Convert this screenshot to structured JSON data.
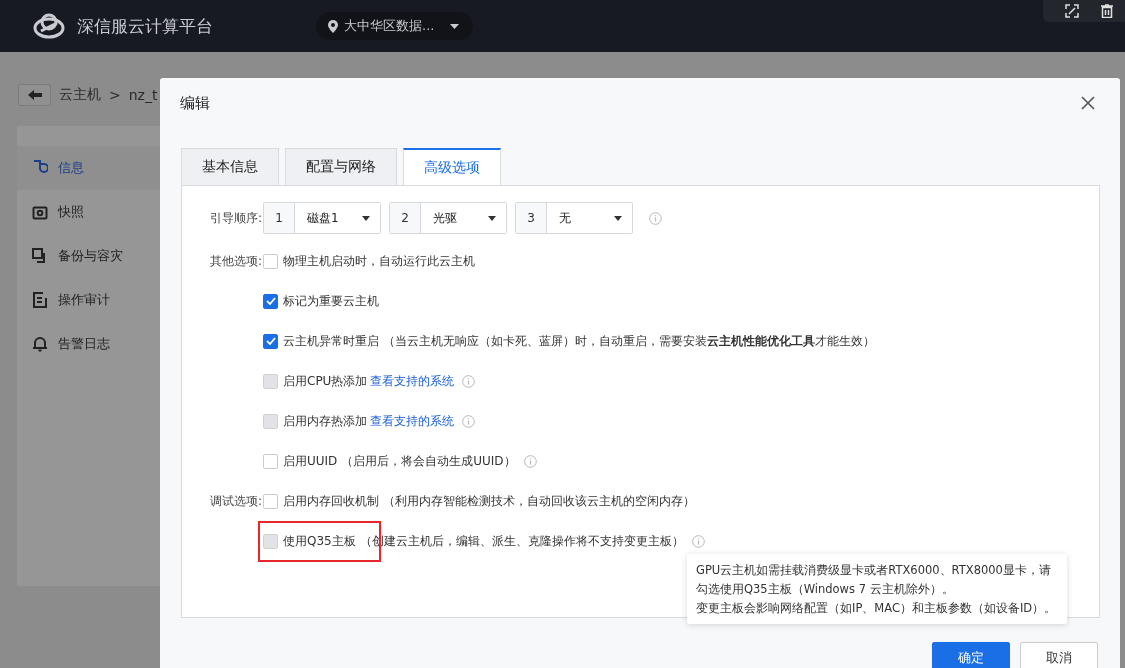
{
  "header": {
    "title": "深信服云计算平台",
    "region": "大中华区数据..."
  },
  "breadcrumb": {
    "items": [
      "云主机",
      ">",
      "nz_t"
    ]
  },
  "sidebar": {
    "items": [
      {
        "label": "信息",
        "selected": true
      },
      {
        "label": "快照",
        "selected": false
      },
      {
        "label": "备份与容灾",
        "selected": false
      },
      {
        "label": "操作审计",
        "selected": false
      },
      {
        "label": "告警日志",
        "selected": false
      }
    ]
  },
  "dialog": {
    "title": "编辑",
    "tabs": [
      {
        "label": "基本信息",
        "selected": false
      },
      {
        "label": "配置与网络",
        "selected": false
      },
      {
        "label": "高级选项",
        "selected": true
      }
    ],
    "boot_order": {
      "label": "引导顺序:",
      "slots": [
        {
          "index": "1",
          "value": "磁盘1"
        },
        {
          "index": "2",
          "value": "光驱"
        },
        {
          "index": "3",
          "value": "无"
        }
      ]
    },
    "groups": [
      {
        "label": "其他选项:",
        "options": [
          {
            "label": "物理主机启动时，自动运行此云主机",
            "checked": false,
            "disabled": false
          },
          {
            "label": "标记为重要云主机",
            "checked": true,
            "disabled": false
          },
          {
            "label": "云主机异常时重启 （当云主机无响应（如卡死、蓝屏）时，自动重启，需要安装**云主机性能优化工具**才能生效）",
            "checked": true,
            "disabled": false
          },
          {
            "label": "启用CPU热添加",
            "link": "查看支持的系统",
            "info": true,
            "checked": false,
            "disabled": true
          },
          {
            "label": "启用内存热添加",
            "link": "查看支持的系统",
            "info": true,
            "checked": false,
            "disabled": true
          },
          {
            "label": "启用UUID （启用后，将会自动生成UUID）",
            "info": true,
            "checked": false,
            "disabled": false
          }
        ]
      },
      {
        "label": "调试选项:",
        "options": [
          {
            "label": "启用内存回收机制 （利用内存智能检测技术，自动回收该云主机的空闲内存）",
            "checked": false,
            "disabled": false
          },
          {
            "label": "使用Q35主板 （创建云主机后，编辑、派生、克隆操作将不支持变更主板）",
            "info": true,
            "checked": false,
            "disabled": true,
            "highlighted": true
          }
        ]
      }
    ],
    "tooltip": [
      "GPU云主机如需挂载消费级显卡或者RTX6000、RTX8000显卡，请",
      "勾选使用Q35主板（Windows 7 云主机除外）。",
      "变更主板会影响网络配置（如IP、MAC）和主板参数（如设备ID）。"
    ],
    "buttons": [
      {
        "label": "确定",
        "kind": "primary"
      },
      {
        "label": "取消",
        "kind": "secondary"
      }
    ]
  }
}
